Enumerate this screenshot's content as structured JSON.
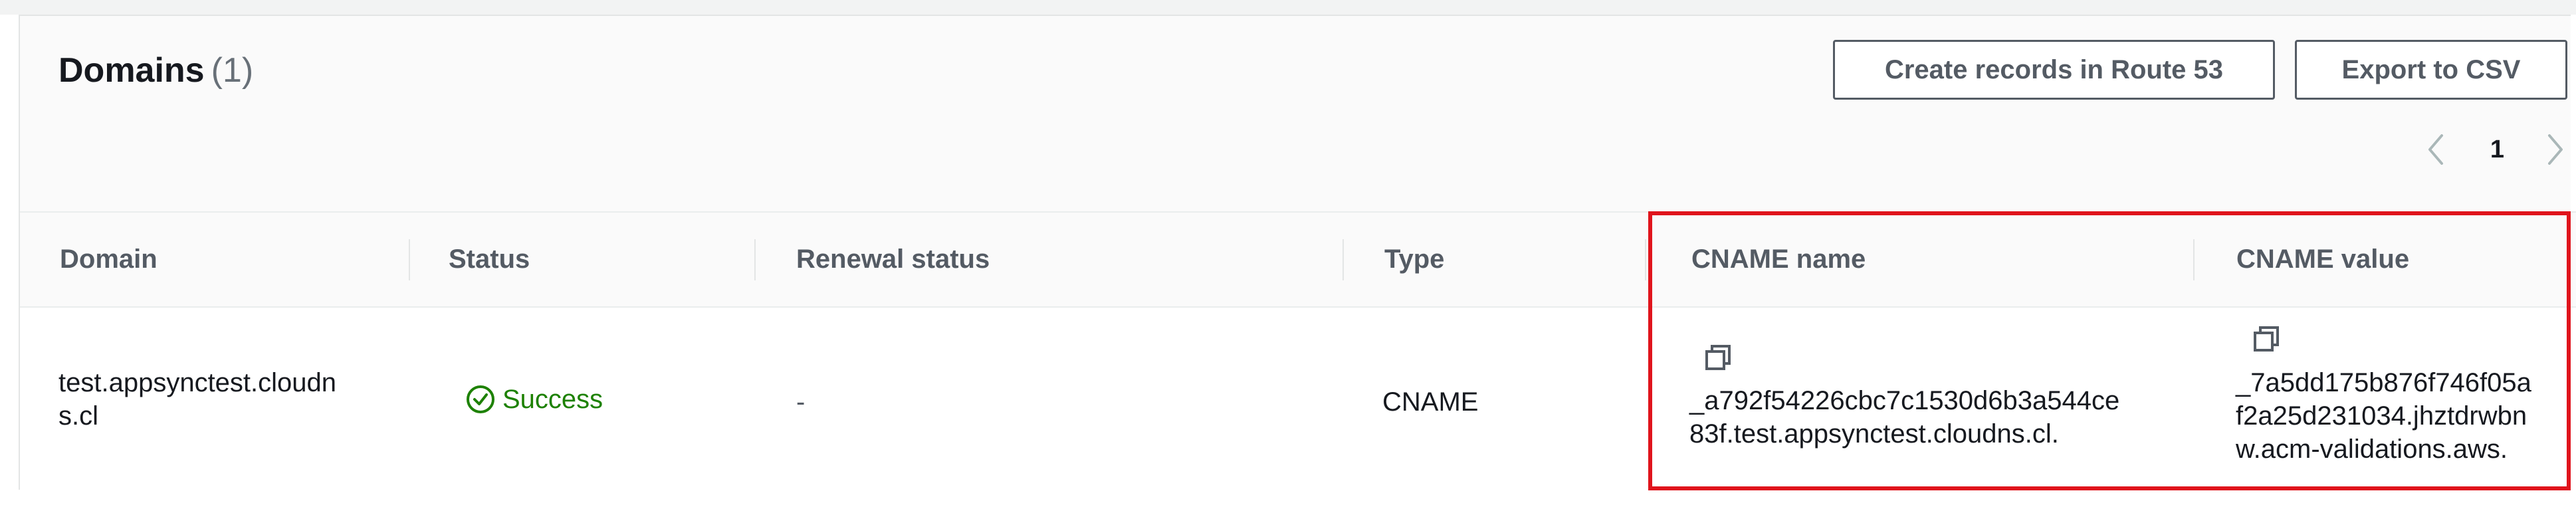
{
  "header": {
    "title": "Domains",
    "count": "(1)"
  },
  "buttons": {
    "route53": "Create records in Route 53",
    "export_csv": "Export to CSV"
  },
  "pagination": {
    "current_page": "1"
  },
  "table": {
    "columns": [
      "Domain",
      "Status",
      "Renewal status",
      "Type",
      "CNAME name",
      "CNAME value"
    ],
    "rows": [
      {
        "domain_line1": "test.appsynctest.cloudn",
        "domain_line2": "s.cl",
        "status": "Success",
        "renewal_status": "-",
        "type": "CNAME",
        "cname_name_line1": "_a792f54226cbc7c1530d6b3a544ce",
        "cname_name_line2": "83f.test.appsynctest.cloudns.cl.",
        "cname_value_line1": "_7a5dd175b876f746f05a",
        "cname_value_line2": "f2a25d231034.jhztdrwbn",
        "cname_value_line3": "w.acm-validations.aws."
      }
    ]
  },
  "icons": {
    "success": "check-circle-icon",
    "copy": "copy-icon",
    "prev": "chevron-left-icon",
    "next": "chevron-right-icon"
  },
  "colors": {
    "success": "#1d8102",
    "highlight": "#e0141c",
    "button_border": "#545b64"
  }
}
